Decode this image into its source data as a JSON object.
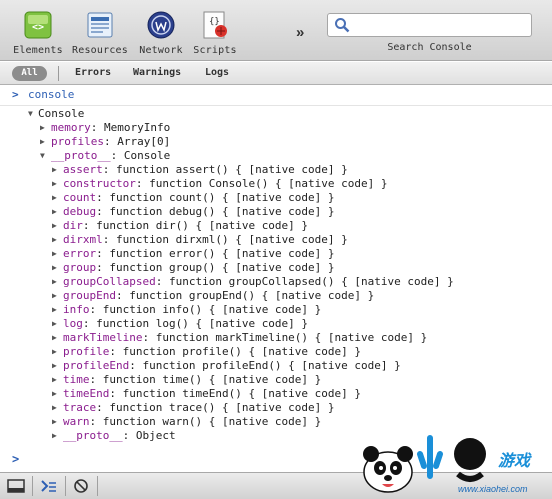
{
  "toolbar": {
    "tools": [
      {
        "label": "Elements",
        "icon": "elements-icon"
      },
      {
        "label": "Resources",
        "icon": "resources-icon"
      },
      {
        "label": "Network",
        "icon": "network-icon"
      },
      {
        "label": "Scripts",
        "icon": "scripts-icon"
      }
    ],
    "overflow": "»",
    "search": {
      "value": "",
      "caption": "Search Console"
    }
  },
  "filters": {
    "active": "All",
    "tabs": [
      "Errors",
      "Warnings",
      "Logs"
    ]
  },
  "console": {
    "prompt_symbol": ">",
    "command": "console",
    "object": {
      "name": "Console"
    },
    "properties": [
      {
        "key": "memory",
        "value": "MemoryInfo"
      },
      {
        "key": "profiles",
        "value": "Array[0]"
      }
    ],
    "proto": {
      "key": "__proto__",
      "value": "Console"
    },
    "methods": [
      {
        "key": "assert",
        "value": "function assert() { [native code] }"
      },
      {
        "key": "constructor",
        "value": "function Console() { [native code] }"
      },
      {
        "key": "count",
        "value": "function count() { [native code] }"
      },
      {
        "key": "debug",
        "value": "function debug() { [native code] }"
      },
      {
        "key": "dir",
        "value": "function dir() { [native code] }"
      },
      {
        "key": "dirxml",
        "value": "function dirxml() { [native code] }"
      },
      {
        "key": "error",
        "value": "function error() { [native code] }"
      },
      {
        "key": "group",
        "value": "function group() { [native code] }"
      },
      {
        "key": "groupCollapsed",
        "value": "function groupCollapsed() { [native code] }"
      },
      {
        "key": "groupEnd",
        "value": "function groupEnd() { [native code] }"
      },
      {
        "key": "info",
        "value": "function info() { [native code] }"
      },
      {
        "key": "log",
        "value": "function log() { [native code] }"
      },
      {
        "key": "markTimeline",
        "value": "function markTimeline() { [native code] }"
      },
      {
        "key": "profile",
        "value": "function profile() { [native code] }"
      },
      {
        "key": "profileEnd",
        "value": "function profileEnd() { [native code] }"
      },
      {
        "key": "time",
        "value": "function time() { [native code] }"
      },
      {
        "key": "timeEnd",
        "value": "function timeEnd() { [native code] }"
      },
      {
        "key": "trace",
        "value": "function trace() { [native code] }"
      },
      {
        "key": "warn",
        "value": "function warn() { [native code] }"
      },
      {
        "key": "__proto__",
        "value": "Object"
      }
    ],
    "input_prompt": ">"
  },
  "statusbar": {
    "buttons": [
      "dock-window-icon",
      "console-drawer-icon",
      "clear-console-icon"
    ]
  },
  "watermark": {
    "url": "www.xiaohei.com"
  },
  "colors": {
    "property_key": "#8a1c8e",
    "prompt": "#2d5fb4",
    "toolbar_bg": "#dcdcdc"
  }
}
